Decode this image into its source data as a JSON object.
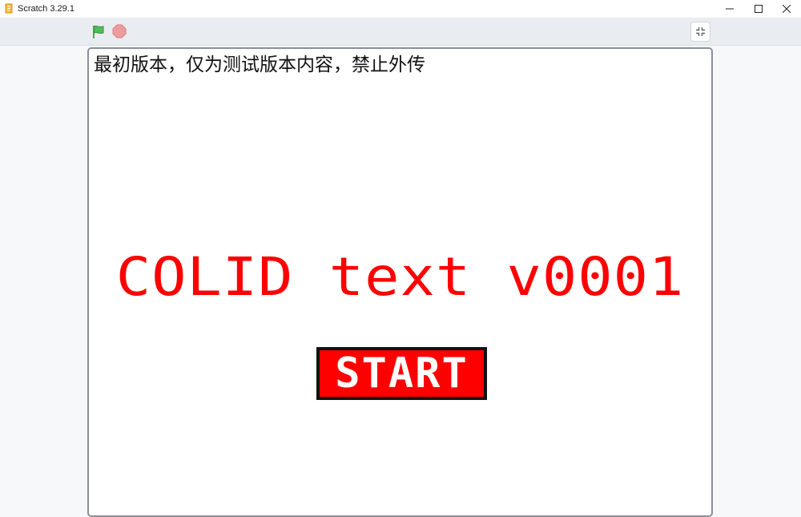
{
  "window": {
    "title": "Scratch 3.29.1"
  },
  "toolbar": {
    "green_flag_icon": "green-flag-icon",
    "stop_icon": "stop-icon",
    "exit_fullscreen_icon": "exit-fullscreen-icon"
  },
  "stage": {
    "notice": "最初版本，仅为测试版本内容，禁止外传",
    "title": "COLID text v0001",
    "start_label": "START"
  },
  "colors": {
    "title_red": "#ff0000",
    "button_red": "#ff0000",
    "flag_green": "#4cbf56",
    "stop_red": "#ec9c9c",
    "toolbar_bg": "#e9ecf1"
  }
}
